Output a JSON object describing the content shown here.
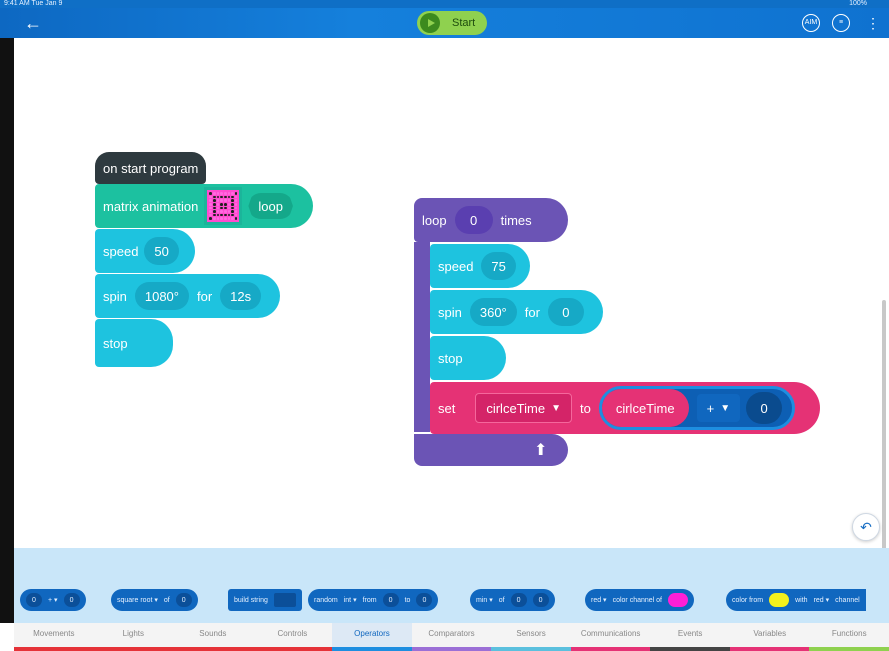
{
  "status": {
    "time": "9:41 AM   Tue Jan 9",
    "battery": "100%"
  },
  "header": {
    "start_label": "Start",
    "icons": [
      "back-arrow-icon",
      "play-icon",
      "aim-icon",
      "remote-icon",
      "more-vertical-icon"
    ],
    "aim_label": "AIM"
  },
  "left_stack": {
    "hat_label": "on start program",
    "matrix_label": "matrix animation",
    "matrix_mode": "loop",
    "speed_label": "speed",
    "speed_value": "50",
    "spin_label": "spin",
    "spin_degrees": "1080°",
    "spin_for": "for",
    "spin_duration": "12s",
    "stop_label": "stop"
  },
  "right_stack": {
    "loop_label": "loop",
    "loop_count": "0",
    "loop_times": "times",
    "speed_label": "speed",
    "speed_value": "75",
    "spin_label": "spin",
    "spin_degrees": "360°",
    "spin_for": "for",
    "spin_duration": "0",
    "stop_label": "stop",
    "set_label": "set",
    "set_var": "cirlceTime",
    "set_to": "to",
    "expr_var": "cirlceTime",
    "expr_op": "+",
    "expr_value": "0"
  },
  "palette": {
    "chips": [
      {
        "a": "0",
        "b": "+ ▾",
        "c": "0"
      },
      {
        "a": "square root ▾",
        "b": "of",
        "c": "0"
      },
      {
        "a": "build string"
      },
      {
        "a": "random",
        "b": "int ▾",
        "c": "from",
        "d": "0",
        "e": "to",
        "f": "0"
      },
      {
        "a": "min ▾",
        "b": "of",
        "c": "0",
        "d": "0"
      },
      {
        "a": "red ▾",
        "b": "color channel of"
      },
      {
        "a": "color from",
        "b": "with",
        "c": "red ▾",
        "d": "channel"
      }
    ],
    "colors": {
      "magenta": "#ff1fd6",
      "yellow": "#f4f01c"
    }
  },
  "tabs": [
    {
      "label": "Movements",
      "color": "#e53238"
    },
    {
      "label": "Lights",
      "color": "#e53238"
    },
    {
      "label": "Sounds",
      "color": "#e53238"
    },
    {
      "label": "Controls",
      "color": "#e53238"
    },
    {
      "label": "Operators",
      "color": "#1e8ee0"
    },
    {
      "label": "Comparators",
      "color": "#9b6fd6"
    },
    {
      "label": "Sensors",
      "color": "#5bc0de"
    },
    {
      "label": "Communications",
      "color": "#e53275"
    },
    {
      "label": "Events",
      "color": "#444444"
    },
    {
      "label": "Variables",
      "color": "#e53275"
    },
    {
      "label": "Functions",
      "color": "#8fd14f"
    }
  ]
}
